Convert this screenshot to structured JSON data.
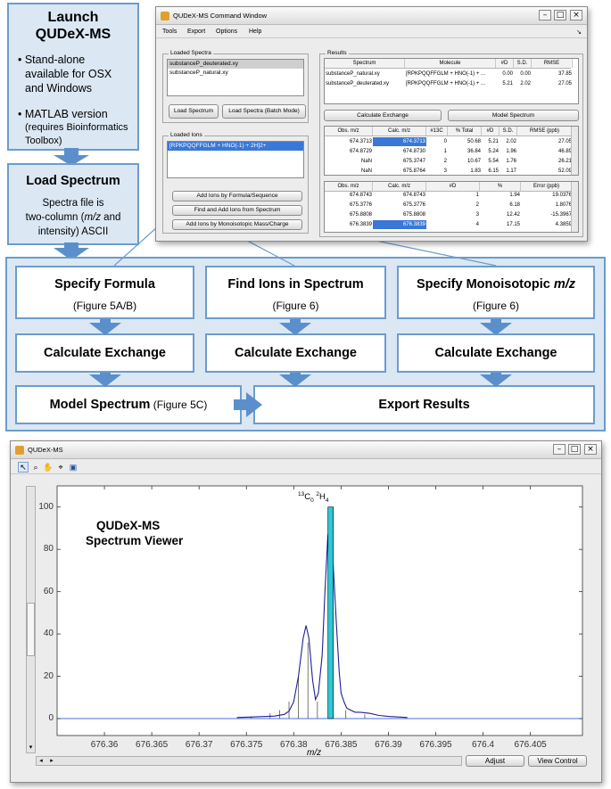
{
  "flow": {
    "launch": {
      "title_line1": "Launch",
      "title_line2": "QUDeX-MS",
      "bullet1_line1": "• Stand-alone",
      "bullet1_line2": "available for OSX",
      "bullet1_line3": "and Windows",
      "bullet2_line1": "• MATLAB version",
      "bullet2_line2": "(requires Bioinformatics",
      "bullet2_line3": "Toolbox)"
    },
    "load": {
      "title": "Load Spectrum",
      "line1": "Spectra file is",
      "line2_pre": "two-column (",
      "line2_italic": "m/z",
      "line2_post": " and",
      "line3": "intensity) ASCII"
    },
    "specify_formula": {
      "title": "Specify Formula",
      "sub": "(Figure 5A/B)"
    },
    "find_ions": {
      "title": "Find Ions in Spectrum",
      "sub": "(Figure 6)"
    },
    "specify_mono": {
      "title_pre": "Specify Monoisotopic ",
      "title_italic": "m/z",
      "sub": "(Figure 6)"
    },
    "calc_exchange_1": "Calculate Exchange",
    "calc_exchange_2": "Calculate Exchange",
    "calc_exchange_3": "Calculate Exchange",
    "model_spectrum": {
      "title": "Model Spectrum",
      "sub": " (Figure 5C)"
    },
    "export_results": "Export Results"
  },
  "command_window": {
    "title": "QUDeX-MS Command Window",
    "menu": [
      "Tools",
      "Export",
      "Options",
      "Help"
    ],
    "loaded_spectra": {
      "label": "Loaded Spectra",
      "items": [
        "substanceP_deuterated.xy",
        "substanceP_natural.xy"
      ]
    },
    "load_spectrum_btn": "Load Spectrum",
    "load_batch_btn": "Load Spectra (Batch Mode)",
    "loaded_ions": {
      "label": "Loaded Ions",
      "items": [
        "[RPKPQQFFGLM + HNO(-1) + 2H]2+"
      ]
    },
    "add_formula_btn": "Add Ions by Formula/Sequence",
    "find_add_btn": "Find and Add Ions from Spectrum",
    "add_mono_btn": "Add Ions by Monoisotopic Mass/Charge",
    "results": {
      "label": "Results",
      "headers": [
        "Spectrum",
        "Molecule",
        "#D",
        "S.D.",
        "RMSE"
      ],
      "rows": [
        [
          "substanceP_natural.xy",
          "[RPKPQQFFGLM + HNO(-1) + ...",
          "0.00",
          "0.00",
          "37.85"
        ],
        [
          "substanceP_deuterated.xy",
          "[RPKPQQFFGLM + HNO(-1) + ...",
          "5.21",
          "2.02",
          "27.05"
        ]
      ]
    },
    "calc_exchange_btn": "Calculate Exchange",
    "model_spectrum_btn": "Model Spectrum",
    "table1": {
      "headers": [
        "Obs. m/z",
        "Calc. m/z",
        "#13C",
        "% Total",
        "#D",
        "S.D.",
        "RMSE (ppb)"
      ],
      "rows": [
        [
          "674.3713",
          "674.3713",
          "0",
          "50.68",
          "5.21",
          "2.02",
          "27.05"
        ],
        [
          "674.8729",
          "674.8730",
          "1",
          "36.84",
          "5.24",
          "1.96",
          "46.89"
        ],
        [
          "NaN",
          "675.3747",
          "2",
          "10.67",
          "5.54",
          "1.76",
          "26.21"
        ],
        [
          "NaN",
          "675.8764",
          "3",
          "1.83",
          "6.15",
          "1.17",
          "52.09"
        ]
      ]
    },
    "table2": {
      "headers": [
        "Obs. m/z",
        "Calc. m/z",
        "#D",
        "%",
        "Error (ppb)"
      ],
      "rows": [
        [
          "674.8743",
          "674.8743",
          "1",
          "1.94",
          "19.0376"
        ],
        [
          "675.3776",
          "675.3776",
          "2",
          "6.18",
          "1.8076"
        ],
        [
          "675.8808",
          "675.8808",
          "3",
          "12.42",
          "-15.3967"
        ],
        [
          "676.3839",
          "676.3839",
          "4",
          "17.15",
          "4.3859"
        ]
      ]
    }
  },
  "viewer": {
    "title": "QUDeX-MS",
    "label_line1": "QUDeX-MS",
    "label_line2": "Spectrum Viewer",
    "peak_label_c_num": "13",
    "peak_label_c": "C",
    "peak_label_c_sub": "0",
    "peak_label_h_num": "2",
    "peak_label_h": "H",
    "peak_label_h_sub": "4",
    "adjust_btn": "Adjust",
    "view_control_btn": "View Control",
    "toolbar_icons": [
      "pointer-icon",
      "zoom-in-icon",
      "pan-icon",
      "data-cursor-icon",
      "save-icon"
    ]
  },
  "chart_data": {
    "type": "line",
    "xlabel": "m/z",
    "ylabel": "",
    "xlim": [
      676.355,
      676.4105
    ],
    "ylim": [
      -8,
      110
    ],
    "x_ticks": [
      "676.36",
      "676.365",
      "676.37",
      "676.375",
      "676.38",
      "676.385",
      "676.39",
      "676.395",
      "676.4",
      "676.405"
    ],
    "x_tick_values": [
      676.36,
      676.365,
      676.37,
      676.375,
      676.38,
      676.385,
      676.39,
      676.395,
      676.4,
      676.405
    ],
    "y_ticks": [
      "0",
      "20",
      "40",
      "60",
      "80",
      "100"
    ],
    "y_tick_values": [
      0,
      20,
      40,
      60,
      80,
      100
    ],
    "series": [
      {
        "color": "#1f1f8f",
        "x": [
          676.374,
          676.376,
          676.378,
          676.379,
          676.3795,
          676.38,
          676.3805,
          676.381,
          676.3813,
          676.3816,
          676.382,
          676.3823,
          676.3826,
          676.383,
          676.3833,
          676.3836,
          676.3838,
          676.384,
          676.3842,
          676.3845,
          676.3848,
          676.385,
          676.3853,
          676.3856,
          676.386,
          676.3865,
          676.387,
          676.388,
          676.389,
          676.39,
          676.392
        ],
        "values": [
          0.5,
          0.8,
          1.2,
          2,
          3.5,
          8,
          20,
          38,
          44,
          38,
          18,
          9,
          12,
          30,
          60,
          86,
          93,
          91,
          70,
          45,
          22,
          12,
          8,
          5,
          4,
          3,
          3,
          2.5,
          1.5,
          1,
          0.5
        ]
      }
    ],
    "sticks": [
      {
        "x": 676.3839,
        "value": 100,
        "color": "#2bc8d8"
      }
    ],
    "small_sticks": [
      {
        "x": 676.3755,
        "value": 1
      },
      {
        "x": 676.3775,
        "value": 2.5
      },
      {
        "x": 676.3785,
        "value": 4
      },
      {
        "x": 676.3795,
        "value": 8
      },
      {
        "x": 676.3805,
        "value": 20
      },
      {
        "x": 676.3815,
        "value": 36
      },
      {
        "x": 676.3825,
        "value": 8
      },
      {
        "x": 676.3855,
        "value": 4
      },
      {
        "x": 676.3875,
        "value": 2
      }
    ],
    "baseline": 0
  },
  "colors": {
    "flow_border": "#6c9ccc",
    "flow_fill": "#dbe7f3",
    "arrow": "#5b8fcb",
    "selection": "#3a78d8",
    "peak_bar": "#2bc8d8"
  }
}
